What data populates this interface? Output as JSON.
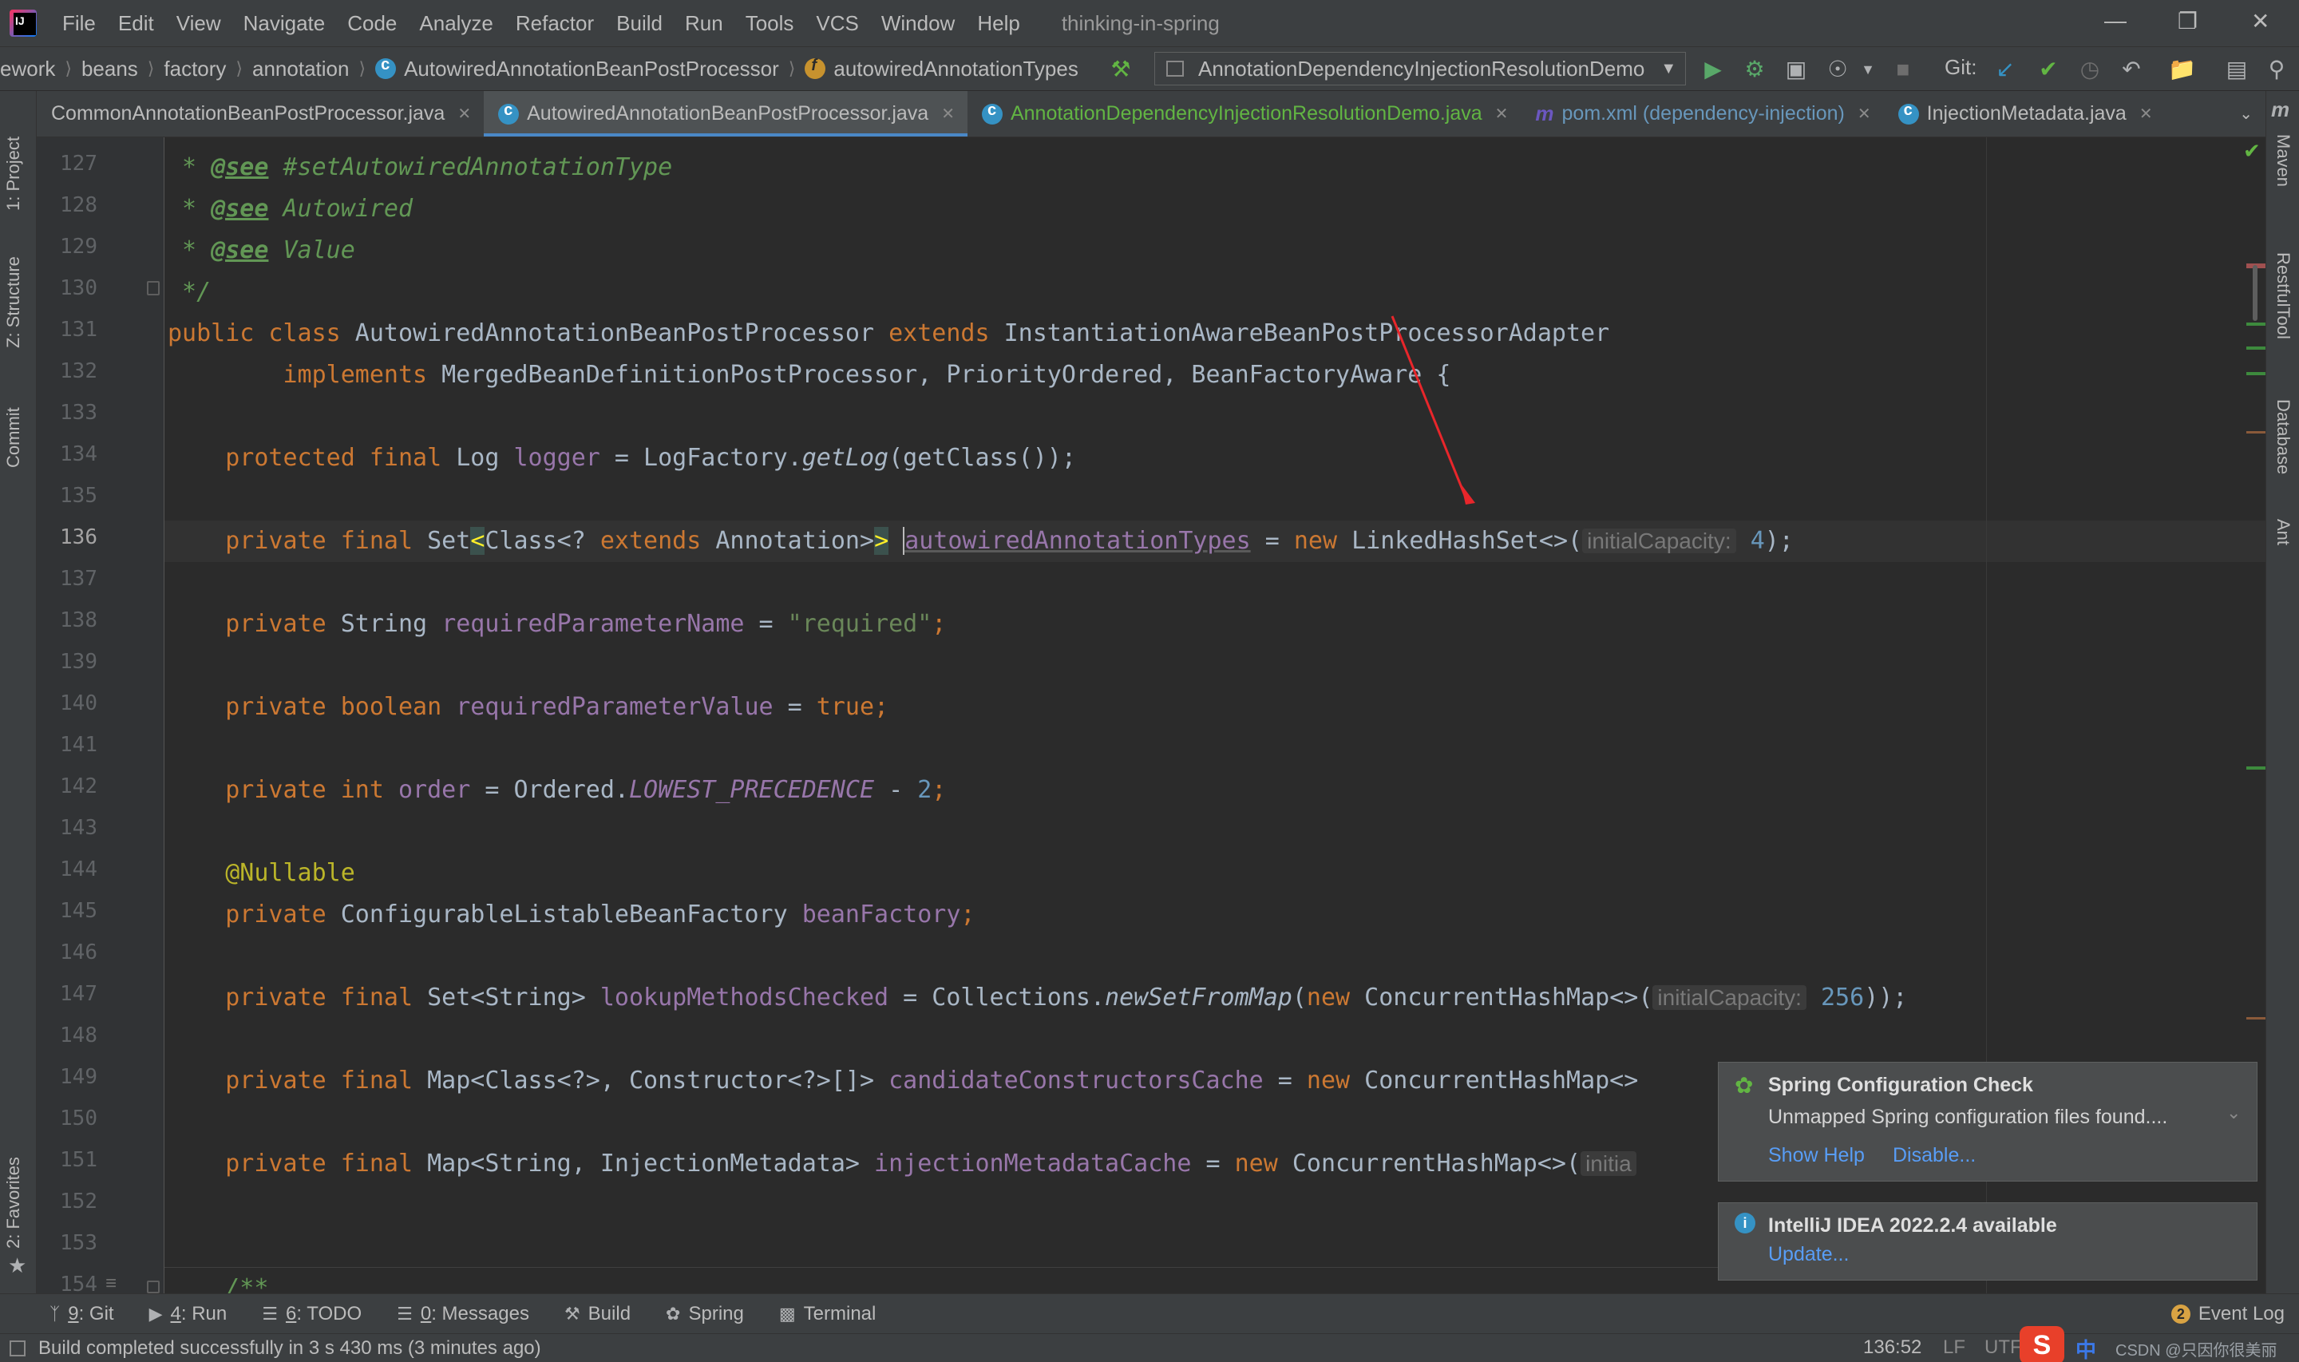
{
  "menubar": {
    "items": [
      "File",
      "Edit",
      "View",
      "Navigate",
      "Code",
      "Analyze",
      "Refactor",
      "Build",
      "Run",
      "Tools",
      "VCS",
      "Window",
      "Help"
    ],
    "project_title": "thinking-in-spring"
  },
  "navbar": {
    "breadcrumbs": [
      "ework",
      "beans",
      "factory",
      "annotation",
      "AutowiredAnnotationBeanPostProcessor",
      "autowiredAnnotationTypes"
    ],
    "run_config": "AnnotationDependencyInjectionResolutionDemo",
    "git_label": "Git:"
  },
  "tabs": [
    {
      "label": "CommonAnnotationBeanPostProcessor.java"
    },
    {
      "label": "AutowiredAnnotationBeanPostProcessor.java"
    },
    {
      "label": "AnnotationDependencyInjectionResolutionDemo.java"
    },
    {
      "label": "pom.xml (dependency-injection)"
    },
    {
      "label": "InjectionMetadata.java"
    }
  ],
  "left_strip": {
    "project": "1: Project",
    "structure": "Z: Structure",
    "commit": "Commit",
    "favorites": "2: Favorites"
  },
  "right_strip": {
    "maven": "Maven",
    "restful": "RestfulTool",
    "database": "Database",
    "ant": "Ant"
  },
  "editor": {
    "line_numbers": [
      "127",
      "128",
      "129",
      "130",
      "131",
      "132",
      "133",
      "134",
      "135",
      "136",
      "137",
      "138",
      "139",
      "140",
      "141",
      "142",
      "143",
      "144",
      "145",
      "146",
      "147",
      "148",
      "149",
      "150",
      "151",
      "152",
      "153",
      "154"
    ],
    "current_line": "136",
    "code": {
      "l127_tag": "@see",
      "l127_ref": " #setAutowiredAnnotationType",
      "l128_tag": "@see",
      "l128_ref": " Autowired",
      "l129_tag": "@see",
      "l129_ref": " Value",
      "l130": " */",
      "l131_kw": "public class",
      "l131_name": " AutowiredAnnotationBeanPostProcessor ",
      "l131_ext": "extends",
      "l131_sup": " InstantiationAwareBeanPostProcessorAdapter",
      "l132_kw": "implements",
      "l132_rest": " MergedBeanDefinitionPostProcessor, PriorityOrdered, BeanFactoryAware {",
      "l134_kw": "protected final",
      "l134_type": " Log ",
      "l134_fld": "logger",
      "l134_a": " = LogFactory.",
      "l134_m": "getLog",
      "l134_b": "(getClass());",
      "l136_kw": "private final",
      "l136_type": " Set",
      "l136_lt": "<",
      "l136_mid": "Class<? ",
      "l136_ext": "extends",
      "l136_ann": " Annotation>",
      "l136_gt": ">",
      "l136_fld": "autowiredAnnotationTypes",
      "l136_eq": " = ",
      "l136_new": "new",
      "l136_cls": " LinkedHashSet<>(",
      "l136_hint": "initialCapacity:",
      "l136_num": "4",
      "l136_end": ");",
      "l138_kw": "private",
      "l138_type": " String ",
      "l138_fld": "requiredParameterName",
      "l138_eq": " = ",
      "l138_str": "\"required\"",
      "l138_end": ";",
      "l140_kw": "private boolean",
      "l140_fld": " requiredParameterValue",
      "l140_eq": " = ",
      "l140_val": "true",
      "l140_end": ";",
      "l142_kw": "private int",
      "l142_fld": " order",
      "l142_eq": " = Ordered.",
      "l142_const": "LOWEST_PRECEDENCE",
      "l142_op": " - ",
      "l142_num": "2",
      "l142_end": ";",
      "l144_ann": "@Nullable",
      "l145_kw": "private",
      "l145_type": " ConfigurableListableBeanFactory ",
      "l145_fld": "beanFactory",
      "l145_end": ";",
      "l147_kw": "private final",
      "l147_type": " Set<String> ",
      "l147_fld": "lookupMethodsChecked",
      "l147_a": " = Collections.",
      "l147_m": "newSetFromMap",
      "l147_b": "(",
      "l147_new": "new",
      "l147_cls": " ConcurrentHashMap<>(",
      "l147_hint": "initialCapacity:",
      "l147_num": "256",
      "l147_end": "));",
      "l149_kw": "private final",
      "l149_type": " Map<Class<?>, Constructor<?>[]> ",
      "l149_fld": "candidateConstructorsCache",
      "l149_eq": " = ",
      "l149_new": "new",
      "l149_cls": " ConcurrentHashMap<>",
      "l151_kw": "private final",
      "l151_type": " Map<String, InjectionMetadata> ",
      "l151_fld": "injectionMetadataCache",
      "l151_eq": " = ",
      "l151_new": "new",
      "l151_cls": " ConcurrentHashMap<>(",
      "l151_hint": "initia",
      "l154": "/**"
    }
  },
  "notifications": {
    "spring": {
      "title": "Spring Configuration Check",
      "body": "Unmapped Spring configuration files found....",
      "link1": "Show Help",
      "link2": "Disable..."
    },
    "update": {
      "title": "IntelliJ IDEA 2022.2.4 available",
      "link": "Update..."
    }
  },
  "bottombar": {
    "git_num": "9",
    "git_label": ": Git",
    "run_num": "4",
    "run_label": ": Run",
    "todo_num": "6",
    "todo_label": ": TODO",
    "msg_num": "0",
    "msg_label": ": Messages",
    "build": "Build",
    "spring": "Spring",
    "terminal": "Terminal",
    "event_log": "Event Log",
    "event_count": "2"
  },
  "statusbar": {
    "message": "Build completed successfully in 3 s 430 ms (3 minutes ago)",
    "position": "136:52",
    "line_sep": "LF",
    "encoding": "UTF",
    "watermark": "CSDN @只因你很美丽"
  },
  "colors": {
    "keyword": "#cc7832",
    "field": "#9876aa",
    "string": "#6a8759",
    "number": "#6897bb",
    "doc": "#629755",
    "annotation": "#bbb529",
    "accent": "#4a88c7"
  }
}
